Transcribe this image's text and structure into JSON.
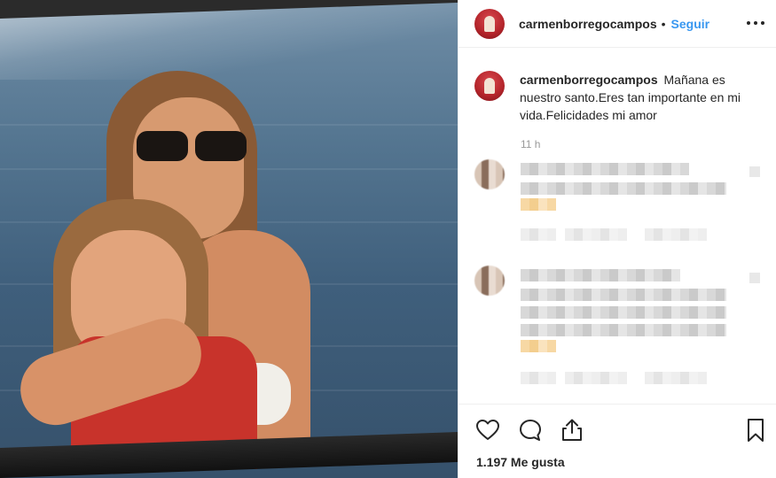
{
  "post": {
    "username": "carmenborregocampos",
    "follow_label": "Seguir",
    "separator": "•",
    "caption": "Mañana es nuestro santo.Eres tan importante en mi vida.Felicidades mi amor",
    "time": "11 h",
    "likes": "1.197 Me gusta"
  },
  "icons": {
    "more": "more-options-icon",
    "like": "heart-icon",
    "comment": "comment-icon",
    "share": "share-icon",
    "save": "bookmark-icon"
  },
  "colors": {
    "accent": "#3897f0",
    "text": "#262626",
    "border": "#efefef"
  }
}
